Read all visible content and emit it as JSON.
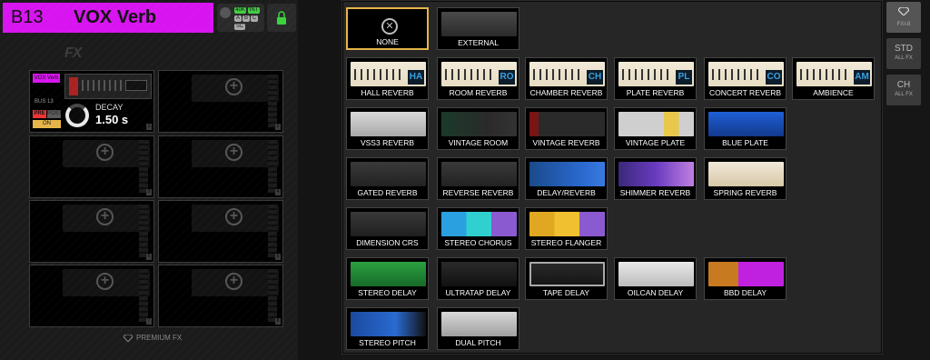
{
  "header": {
    "bus": "B13",
    "title": "VOX Verb",
    "accent": "#d814f0",
    "mini_top": [
      "40K",
      "INT"
    ],
    "mini_abc": [
      "A",
      "B",
      "C"
    ],
    "mini_sc": "SC"
  },
  "fx_logo": "FX",
  "slots": [
    {
      "num": "1",
      "empty": false,
      "badge": "VOX Verb",
      "bus": "BUS 13",
      "pre": "PRE",
      "post": "POST",
      "on": "ON",
      "param": "DECAY",
      "value": "1.50 s"
    },
    {
      "num": "2",
      "empty": true
    },
    {
      "num": "3",
      "empty": true
    },
    {
      "num": "4",
      "empty": true
    },
    {
      "num": "5",
      "empty": true
    },
    {
      "num": "6",
      "empty": true
    },
    {
      "num": "7",
      "empty": true
    },
    {
      "num": "8",
      "empty": true
    }
  ],
  "premium_label": "PREMIUM FX",
  "effects": [
    {
      "label": "NONE"
    },
    {
      "label": "EXTERNAL"
    },
    {
      "label": "HALL REVERB",
      "abbr": "HA"
    },
    {
      "label": "ROOM REVERB",
      "abbr": "RO"
    },
    {
      "label": "CHAMBER REVERB",
      "abbr": "CH"
    },
    {
      "label": "PLATE REVERB",
      "abbr": "PL"
    },
    {
      "label": "CONCERT REVERB",
      "abbr": "CO"
    },
    {
      "label": "AMBIENCE",
      "abbr": "AM"
    },
    {
      "label": "VSS3 REVERB"
    },
    {
      "label": "VINTAGE ROOM"
    },
    {
      "label": "VINTAGE REVERB"
    },
    {
      "label": "VINTAGE PLATE"
    },
    {
      "label": "BLUE PLATE"
    },
    {
      "label": "GATED REVERB"
    },
    {
      "label": "REVERSE REVERB"
    },
    {
      "label": "DELAY/REVERB"
    },
    {
      "label": "SHIMMER REVERB"
    },
    {
      "label": "SPRING REVERB"
    },
    {
      "label": "DIMENSION CRS"
    },
    {
      "label": "STEREO CHORUS"
    },
    {
      "label": "STEREO FLANGER"
    },
    {
      "label": "STEREO DELAY"
    },
    {
      "label": "ULTRATAP DELAY"
    },
    {
      "label": "TAPE DELAY"
    },
    {
      "label": "OILCAN DELAY"
    },
    {
      "label": "BBD DELAY"
    },
    {
      "label": "STEREO PITCH"
    },
    {
      "label": "DUAL PITCH"
    }
  ],
  "tabs": [
    {
      "t1": "",
      "t2": "FXI-8"
    },
    {
      "t1": "STD",
      "t2": "ALL FX"
    },
    {
      "t1": "CH",
      "t2": "ALL FX"
    }
  ]
}
